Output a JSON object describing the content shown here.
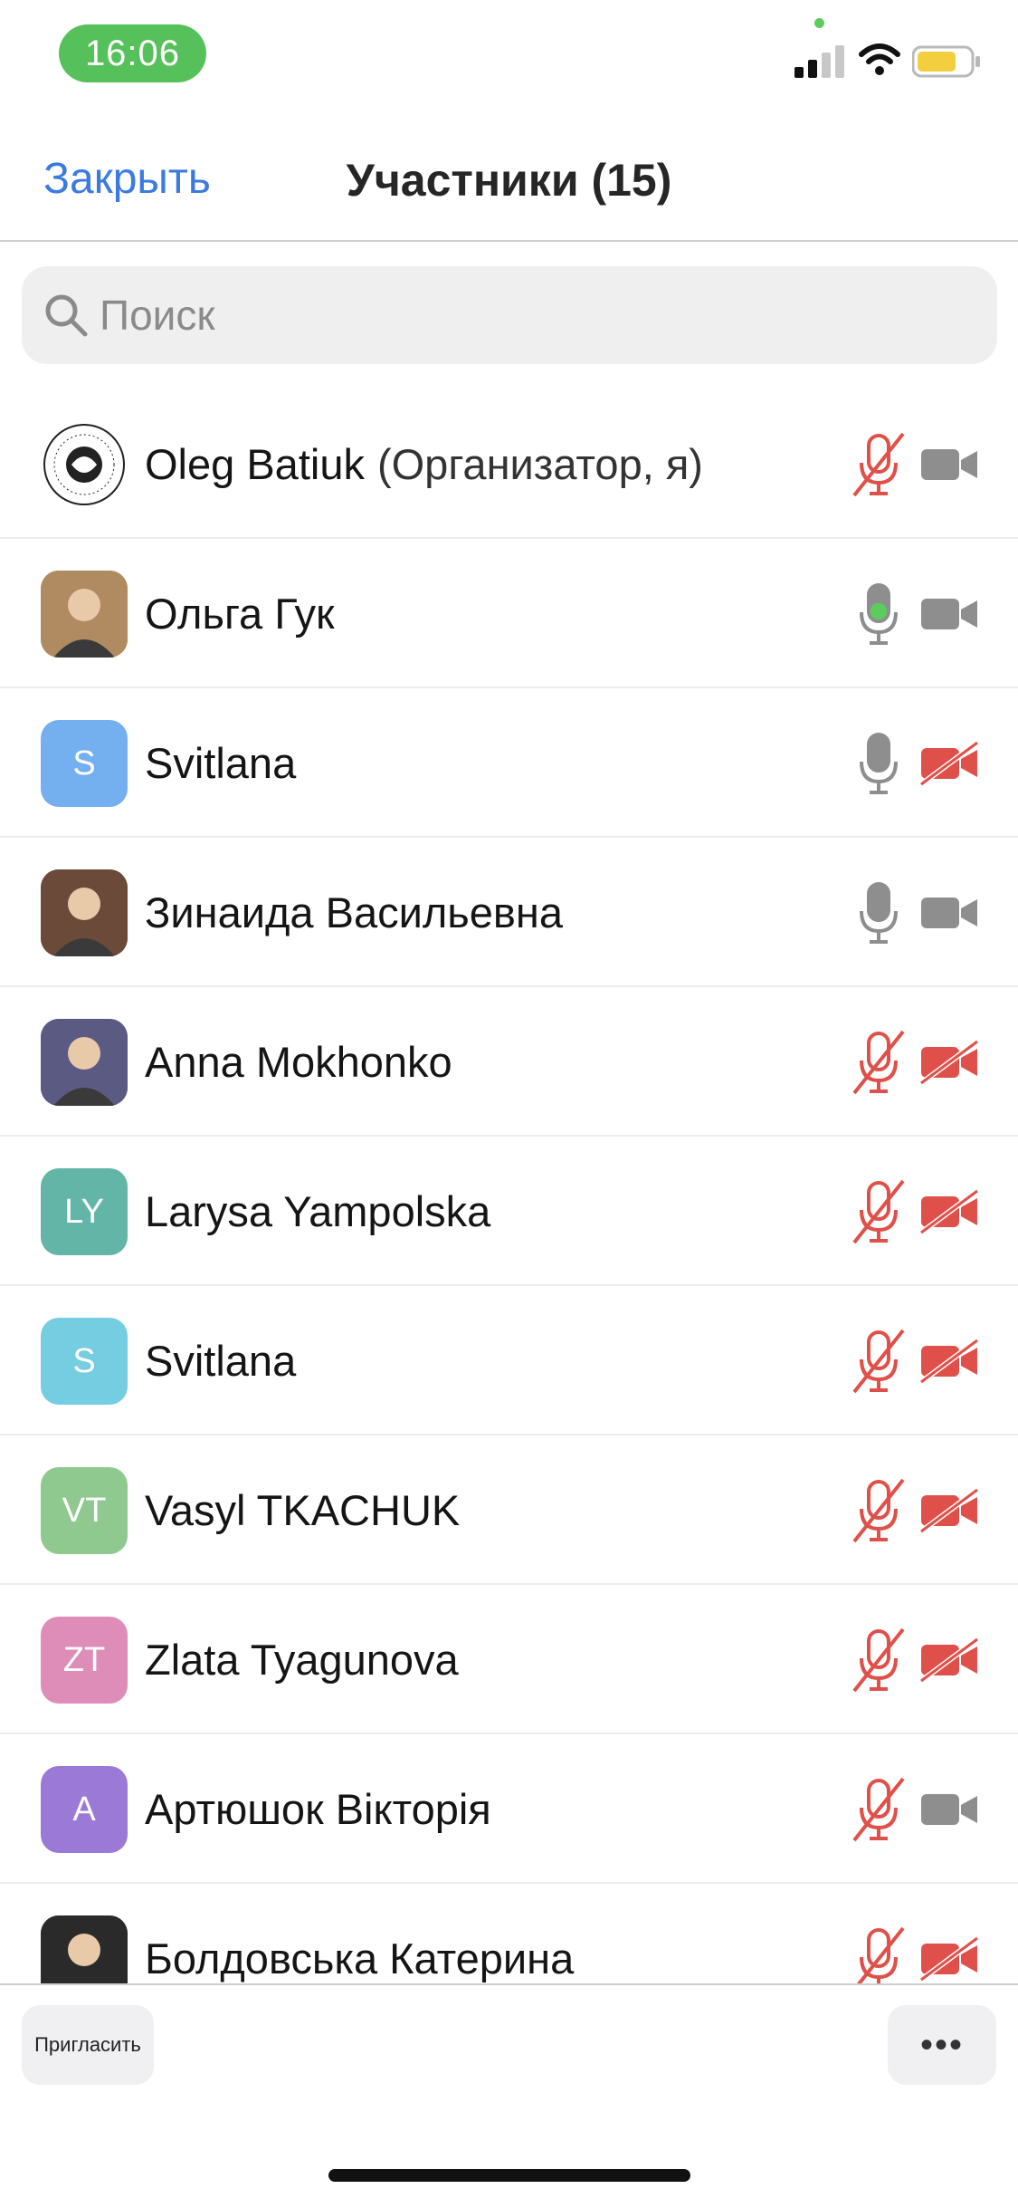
{
  "status": {
    "time": "16:06"
  },
  "header": {
    "close_label": "Закрыть",
    "title": "Участники (15)"
  },
  "search": {
    "placeholder": "Поиск"
  },
  "colors": {
    "accent": "#3b7be0",
    "muted_red": "#e0504a",
    "speaking_green": "#5ccc5c"
  },
  "participants": [
    {
      "name": "Oleg Batiuk",
      "role": "(Организатор, я)",
      "avatar_type": "logo",
      "initials": "",
      "avatar_color": "#ffffff",
      "mic": "muted",
      "video": "on"
    },
    {
      "name": "Ольга Гук",
      "role": "",
      "avatar_type": "photo",
      "initials": "",
      "avatar_color": "#b08a60",
      "mic": "speaking",
      "video": "on"
    },
    {
      "name": "Svitlana",
      "role": "",
      "avatar_type": "initials",
      "initials": "S",
      "avatar_color": "#74b0f0",
      "mic": "on",
      "video": "off"
    },
    {
      "name": "Зинаида Васильевна",
      "role": "",
      "avatar_type": "photo",
      "initials": "",
      "avatar_color": "#6b4a3a",
      "mic": "on",
      "video": "on"
    },
    {
      "name": "Anna Mokhonko",
      "role": "",
      "avatar_type": "photo",
      "initials": "",
      "avatar_color": "#5a5a82",
      "mic": "muted",
      "video": "off"
    },
    {
      "name": "Larysa Yampolska",
      "role": "",
      "avatar_type": "initials",
      "initials": "LY",
      "avatar_color": "#63b5a8",
      "mic": "muted",
      "video": "off"
    },
    {
      "name": "Svitlana",
      "role": "",
      "avatar_type": "initials",
      "initials": "S",
      "avatar_color": "#74cde0",
      "mic": "muted",
      "video": "off"
    },
    {
      "name": "Vasyl TKACHUK",
      "role": "",
      "avatar_type": "initials",
      "initials": "VT",
      "avatar_color": "#8fc98f",
      "mic": "muted",
      "video": "off"
    },
    {
      "name": "Zlata Tyagunova",
      "role": "",
      "avatar_type": "initials",
      "initials": "ZT",
      "avatar_color": "#dd8db8",
      "mic": "muted",
      "video": "off"
    },
    {
      "name": "Артюшок Вікторія",
      "role": "",
      "avatar_type": "initials",
      "initials": "A",
      "avatar_color": "#9a7ad6",
      "mic": "muted",
      "video": "on"
    },
    {
      "name": "Болдовська Катерина",
      "role": "",
      "avatar_type": "photo",
      "initials": "",
      "avatar_color": "#2a2a2a",
      "mic": "muted",
      "video": "off"
    }
  ],
  "footer": {
    "invite_label": "Пригласить",
    "more_label": "•••"
  }
}
